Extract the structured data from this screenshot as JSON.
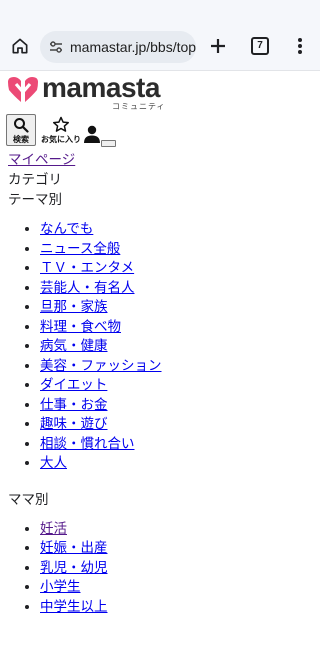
{
  "browser": {
    "url": "mamastar.jp/bbs/top",
    "tab_count": "7"
  },
  "site": {
    "logo_text": "mamasta",
    "logo_sub": "コミュニティ",
    "search_label": "検索",
    "favorites_label": "お気に入り"
  },
  "nav": {
    "mypage": "マイページ",
    "category": "カテゴリ",
    "theme_heading": "テーマ別",
    "theme_items": [
      "なんでも",
      "ニュース全般",
      "ＴＶ・エンタメ",
      "芸能人・有名人",
      "旦那・家族",
      "料理・食べ物",
      "病気・健康",
      "美容・ファッション",
      "ダイエット",
      "仕事・お金",
      "趣味・遊び",
      "相談・慣れ合い",
      "大人"
    ],
    "mama_heading": "ママ別",
    "mama_items": [
      "妊活",
      "妊娠・出産",
      "乳児・幼児",
      "小学生",
      "中学生以上"
    ]
  },
  "colors": {
    "link": "#0000ee",
    "visited_link": "#551a8b",
    "logo_pink": "#ec4a76",
    "chrome_bg": "#f5f7fb"
  }
}
